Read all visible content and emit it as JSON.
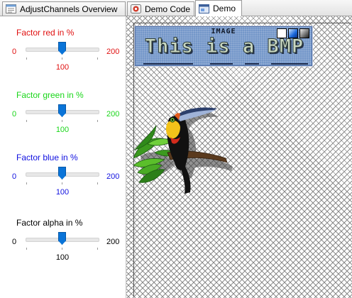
{
  "tabs": [
    {
      "label": "AdjustChannels Overview",
      "icon": "document-icon"
    },
    {
      "label": "Demo Code",
      "icon": "code-icon"
    },
    {
      "label": "Demo",
      "icon": "demo-window-icon",
      "active": true
    }
  ],
  "sliders": [
    {
      "label": "Factor red in %",
      "min": "0",
      "max": "200",
      "value": "100",
      "fraction": 0.5,
      "color": "#e01010"
    },
    {
      "label": "Factor green in %",
      "min": "0",
      "max": "200",
      "value": "100",
      "fraction": 0.5,
      "color": "#19d619"
    },
    {
      "label": "Factor blue in %",
      "min": "0",
      "max": "200",
      "value": "100",
      "fraction": 0.5,
      "color": "#1010e0"
    },
    {
      "label": "Factor alpha in %",
      "min": "0",
      "max": "200",
      "value": "100",
      "fraction": 0.5,
      "color": "#000000"
    }
  ],
  "banner": {
    "subtitle": "IMAGE",
    "title": "This is a BMP"
  },
  "colors": {
    "accent": "#0a74d8",
    "banner_bg": "#7497c9"
  }
}
